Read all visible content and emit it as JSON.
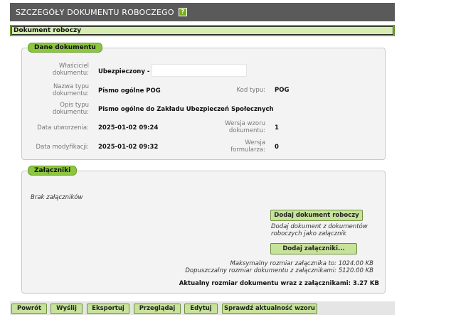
{
  "header": {
    "title": "SZCZEGÓŁY DOKUMENTU ROBOCZEGO",
    "help_label": "?"
  },
  "section": {
    "title": "Dokument roboczy"
  },
  "document": {
    "panel_title": "Dane dokumentu",
    "owner_label": "Właściciel dokumentu:",
    "owner_value": "Ubezpieczony -",
    "type_name_label": "Nazwa typu dokumentu:",
    "type_name_value": "Pismo ogólne POG",
    "type_code_label": "Kod typu:",
    "type_code_value": "POG",
    "type_desc_label": "Opis typu dokumentu:",
    "type_desc_value": "Pismo ogólne do Zakładu Ubezpieczeń Społecznych",
    "created_label": "Data utworzenia:",
    "created_value": "2025-01-02 09:24",
    "pattern_version_label": "Wersja wzoru dokumentu:",
    "pattern_version_value": "1",
    "modified_label": "Data modyfikacji:",
    "modified_value": "2025-01-02 09:32",
    "form_version_label": "Wersja formularza:",
    "form_version_value": "0"
  },
  "attachments": {
    "panel_title": "Załączniki",
    "empty_text": "Brak załączników",
    "add_draft_button": "Dodaj dokument roboczy",
    "add_draft_note": "Dodaj dokument z dokumentów roboczych jako załącznik",
    "add_attachment_button": "Dodaj załączniki...",
    "max_size_text": "Maksymalny rozmiar załącznika to: 1024.00 KB",
    "allowed_size_text": "Dopuszczalny rozmiar dokumentu z załącznikami: 5120.00 KB",
    "current_size_text": "Aktualny rozmiar dokumentu wraz z załącznikami: 3.27 KB"
  },
  "footer": {
    "back": "Powrót",
    "send": "Wyślij",
    "export": "Eksportuj",
    "view": "Przeglądaj",
    "edit": "Edytuj",
    "check": "Sprawdź aktualność wzoru"
  }
}
